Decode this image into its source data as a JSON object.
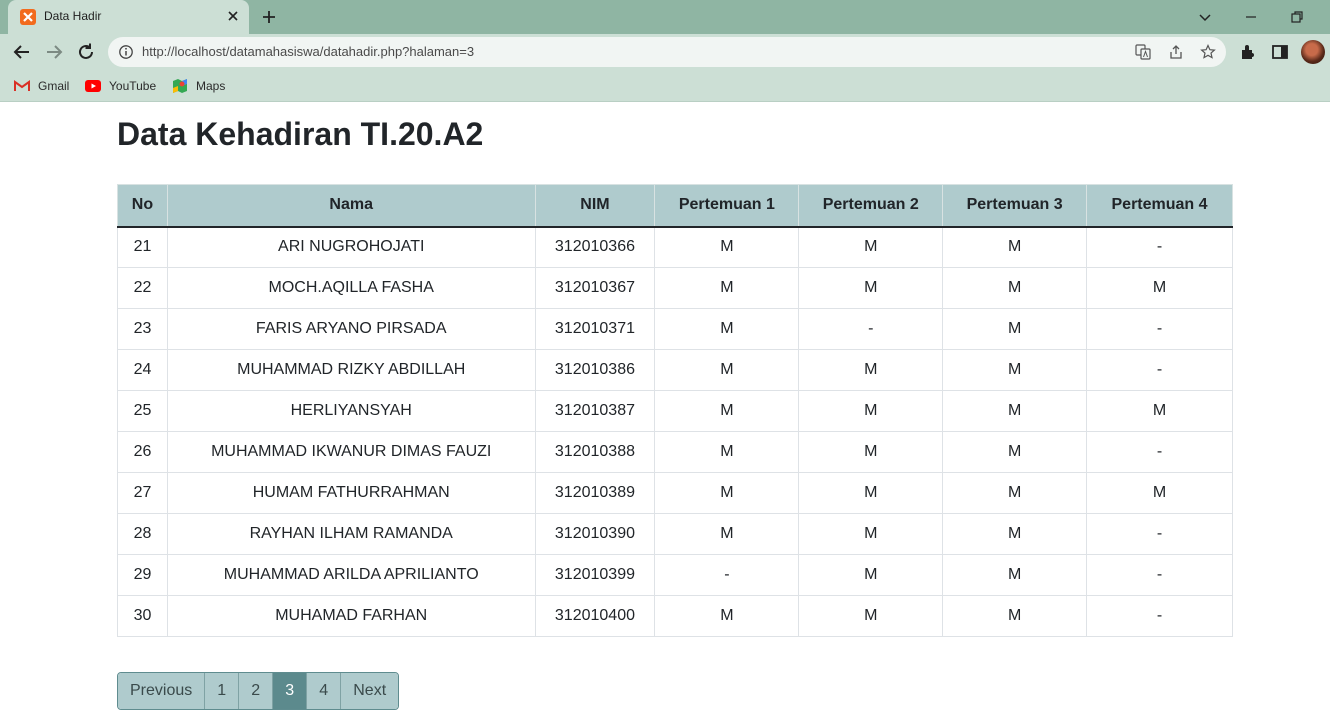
{
  "browser": {
    "tab_title": "Data Hadir",
    "url": "http://localhost/datamahasiswa/datahadir.php?halaman=3",
    "bookmarks": [
      "Gmail",
      "YouTube",
      "Maps"
    ],
    "colors": {
      "frame": "#8fb5a3",
      "toolbar": "#ccdfd5"
    }
  },
  "page": {
    "title": "Data Kehadiran TI.20.A2",
    "columns": [
      "No",
      "Nama",
      "NIM",
      "Pertemuan 1",
      "Pertemuan 2",
      "Pertemuan 3",
      "Pertemuan 4"
    ],
    "rows": [
      [
        "21",
        "ARI NUGROHOJATI",
        "312010366",
        "M",
        "M",
        "M",
        "-"
      ],
      [
        "22",
        "MOCH.AQILLA FASHA",
        "312010367",
        "M",
        "M",
        "M",
        "M"
      ],
      [
        "23",
        "FARIS ARYANO PIRSADA",
        "312010371",
        "M",
        "-",
        "M",
        "-"
      ],
      [
        "24",
        "MUHAMMAD RIZKY ABDILLAH",
        "312010386",
        "M",
        "M",
        "M",
        "-"
      ],
      [
        "25",
        "HERLIYANSYAH",
        "312010387",
        "M",
        "M",
        "M",
        "M"
      ],
      [
        "26",
        "MUHAMMAD IKWANUR DIMAS FAUZI",
        "312010388",
        "M",
        "M",
        "M",
        "-"
      ],
      [
        "27",
        "HUMAM FATHURRAHMAN",
        "312010389",
        "M",
        "M",
        "M",
        "M"
      ],
      [
        "28",
        "RAYHAN ILHAM RAMANDA",
        "312010390",
        "M",
        "M",
        "M",
        "-"
      ],
      [
        "29",
        "MUHAMMAD ARILDA APRILIANTO",
        "312010399",
        "-",
        "M",
        "M",
        "-"
      ],
      [
        "30",
        "MUHAMAD FARHAN",
        "312010400",
        "M",
        "M",
        "M",
        "-"
      ]
    ],
    "pagination": {
      "previous": "Previous",
      "pages": [
        "1",
        "2",
        "3",
        "4"
      ],
      "current": "3",
      "next": "Next"
    },
    "colors": {
      "header_bg": "#afcbcd",
      "active_page": "#5c8a8d"
    }
  }
}
